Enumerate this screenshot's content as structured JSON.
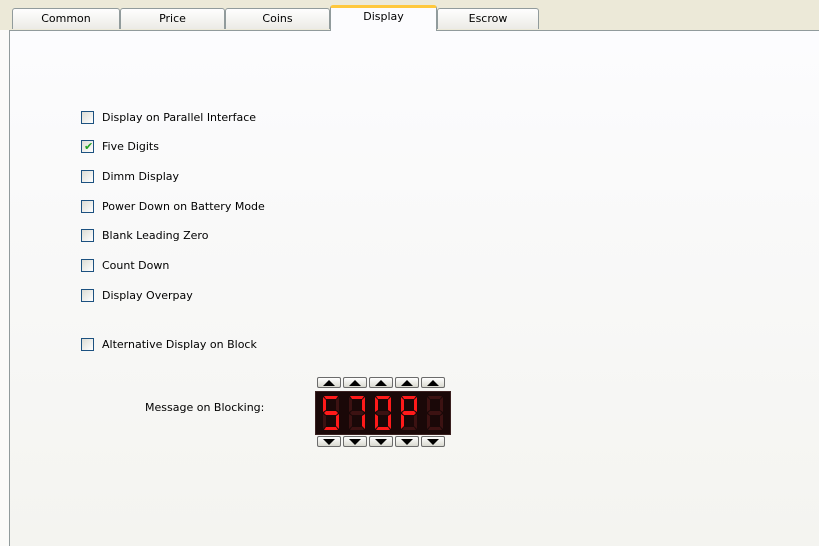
{
  "tabs": [
    {
      "label": "Common",
      "active": false
    },
    {
      "label": "Price",
      "active": false
    },
    {
      "label": "Coins",
      "active": false
    },
    {
      "label": "Display",
      "active": true
    },
    {
      "label": "Escrow",
      "active": false
    }
  ],
  "checkboxes": [
    {
      "label": "Display on Parallel Interface",
      "checked": false
    },
    {
      "label": "Five Digits",
      "checked": true
    },
    {
      "label": "Dimm Display",
      "checked": false
    },
    {
      "label": "Power Down on Battery Mode",
      "checked": false
    },
    {
      "label": "Blank Leading Zero",
      "checked": false
    },
    {
      "label": "Count Down",
      "checked": false
    },
    {
      "label": "Display Overpay",
      "checked": false
    }
  ],
  "alt_display": {
    "label": "Alternative Display on Block",
    "checked": false
  },
  "blocking": {
    "label": "Message on Blocking:",
    "digits": [
      "S",
      "T",
      "O",
      "P",
      ""
    ],
    "on_color": "#ff1a1a",
    "off_color": "#3c1212"
  },
  "colors": {
    "tab_accent": "#ffc83c",
    "check": "#21a121",
    "checkbox_border": "#1c5180"
  }
}
